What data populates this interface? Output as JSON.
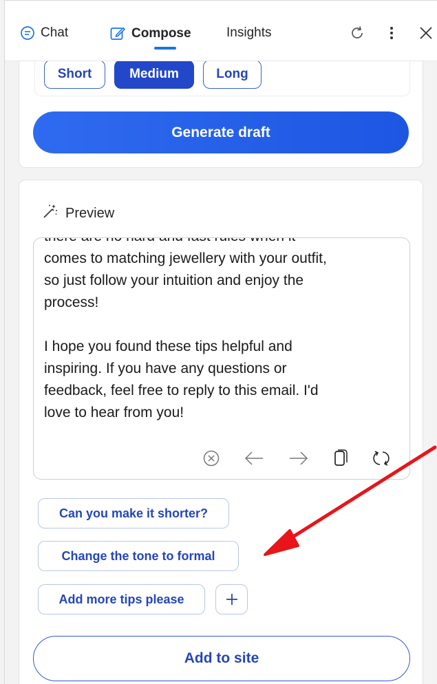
{
  "header": {
    "tabs": [
      {
        "label": "Chat"
      },
      {
        "label": "Compose"
      },
      {
        "label": "Insights"
      }
    ]
  },
  "length": {
    "options": [
      "Short",
      "Medium",
      "Long"
    ],
    "selected": "Medium"
  },
  "generate_label": "Generate draft",
  "preview": {
    "title": "Preview",
    "lines": [
      "there are no hard and fast rules when it",
      "comes to matching jewellery with your outfit,",
      "so just follow your intuition and enjoy the",
      "process!"
    ],
    "lines2": [
      "I hope you found these tips helpful and",
      "inspiring. If you have any questions or",
      "feedback, feel free to reply to this email. I'd",
      "love to hear from you!"
    ]
  },
  "suggestions": [
    "Can you make it shorter?",
    "Change the tone to formal",
    "Add more tips please"
  ],
  "add_to_site_label": "Add to site",
  "colors": {
    "accent": "#2347c9",
    "annotation_arrow": "#e8151b"
  }
}
